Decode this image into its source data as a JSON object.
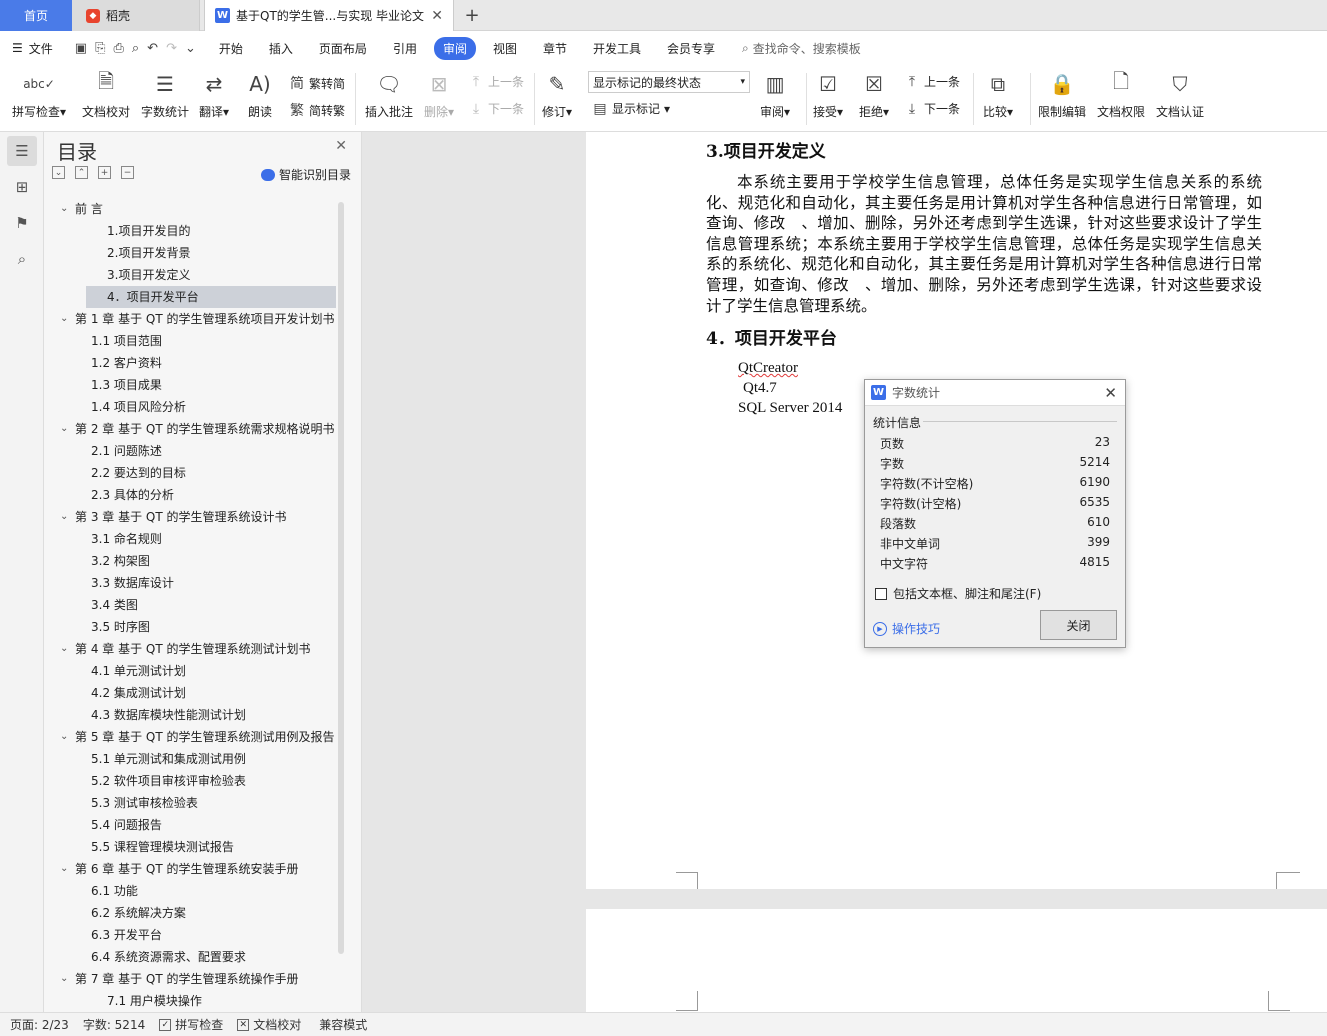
{
  "titlebar": {
    "home_tab": "首页",
    "daoke_tab": "稻壳",
    "doc_tab": "基于QT的学生管...与实现 毕业论文",
    "add_tab": "+"
  },
  "menubar": {
    "file": "文件",
    "tabs": [
      "开始",
      "插入",
      "页面布局",
      "引用",
      "审阅",
      "视图",
      "章节",
      "开发工具",
      "会员专享"
    ],
    "active_tab": "审阅",
    "search_placeholder": "查找命令、搜索模板"
  },
  "ribbon": {
    "spell_check": "拼写检查",
    "doc_proof": "文档校对",
    "word_count": "字数统计",
    "translate": "翻译",
    "read_aloud": "朗读",
    "trad_to_simp": "繁转简",
    "simp_to_trad": "简转繁",
    "insert_comment": "插入批注",
    "delete": "删除",
    "prev_comment": "上一条",
    "next_comment": "下一条",
    "track_changes": "修订",
    "markup_mode": "显示标记的最终状态",
    "show_markup": "显示标记",
    "review": "审阅",
    "accept": "接受",
    "reject": "拒绝",
    "prev_change": "上一条",
    "next_change": "下一条",
    "compare": "比较",
    "restrict_edit": "限制编辑",
    "doc_permission": "文档权限",
    "doc_certify": "文档认证"
  },
  "toc": {
    "title": "目录",
    "smart_recognize": "智能识别目录",
    "items": [
      {
        "level": 1,
        "text": "前 言",
        "expanded": true
      },
      {
        "level": 3,
        "text": "1.项目开发目的"
      },
      {
        "level": 3,
        "text": "2.项目开发背景"
      },
      {
        "level": 3,
        "text": "3.项目开发定义"
      },
      {
        "level": 3,
        "text": "4．项目开发平台",
        "selected": true
      },
      {
        "level": 1,
        "text": "第 1 章 基于 QT 的学生管理系统项目开发计划书",
        "expanded": true
      },
      {
        "level": 2,
        "text": "1.1 项目范围"
      },
      {
        "level": 2,
        "text": "1.2 客户资料"
      },
      {
        "level": 2,
        "text": "1.3 项目成果"
      },
      {
        "level": 2,
        "text": "1.4 项目风险分析"
      },
      {
        "level": 1,
        "text": "第 2 章 基于 QT 的学生管理系统需求规格说明书",
        "expanded": true
      },
      {
        "level": 2,
        "text": "2.1 问题陈述"
      },
      {
        "level": 2,
        "text": "2.2 要达到的目标"
      },
      {
        "level": 2,
        "text": "2.3 具体的分析"
      },
      {
        "level": 1,
        "text": "第 3 章 基于 QT 的学生管理系统设计书",
        "expanded": true
      },
      {
        "level": 2,
        "text": "3.1 命名规则"
      },
      {
        "level": 2,
        "text": "3.2 构架图"
      },
      {
        "level": 2,
        "text": "3.3 数据库设计"
      },
      {
        "level": 2,
        "text": "3.4 类图"
      },
      {
        "level": 2,
        "text": "3.5 时序图"
      },
      {
        "level": 1,
        "text": "第 4 章 基于 QT 的学生管理系统测试计划书",
        "expanded": true
      },
      {
        "level": 2,
        "text": "4.1 单元测试计划"
      },
      {
        "level": 2,
        "text": "4.2 集成测试计划"
      },
      {
        "level": 2,
        "text": "4.3 数据库模块性能测试计划"
      },
      {
        "level": 1,
        "text": "第 5 章 基于 QT 的学生管理系统测试用例及报告",
        "expanded": true
      },
      {
        "level": 2,
        "text": "5.1 单元测试和集成测试用例"
      },
      {
        "level": 2,
        "text": "5.2 软件项目审核评审检验表"
      },
      {
        "level": 2,
        "text": "5.3 测试审核检验表"
      },
      {
        "level": 2,
        "text": "5.4 问题报告"
      },
      {
        "level": 2,
        "text": "5.5 课程管理模块测试报告"
      },
      {
        "level": 1,
        "text": "第 6 章 基于 QT 的学生管理系统安装手册",
        "expanded": true
      },
      {
        "level": 2,
        "text": "6.1 功能"
      },
      {
        "level": 2,
        "text": "6.2 系统解决方案"
      },
      {
        "level": 2,
        "text": "6.3 开发平台"
      },
      {
        "level": 2,
        "text": "6.4 系统资源需求、配置要求"
      },
      {
        "level": 1,
        "text": "第 7 章 基于 QT 的学生管理系统操作手册",
        "expanded": true
      },
      {
        "level": 3,
        "text": "7.1 用户模块操作"
      }
    ]
  },
  "document": {
    "heading3": "3.项目开发定义",
    "paragraph": "本系统主要用于学校学生信息管理，总体任务是实现学生信息关系的系统化、规范化和自动化，其主要任务是用计算机对学生各种信息进行日常管理，如查询、修改　、增加、删除，另外还考虑到学生选课，针对这些要求设计了学生信息管理系统；本系统主要用于学校学生信息管理，总体任务是实现学生信息关系的系统化、规范化和自动化，其主要任务是用计算机对学生各种信息进行日常管理，如查询、修改　、增加、删除，另外还考虑到学生选课，针对这些要求设计了学生信息管理系统。",
    "heading4": "4．项目开发平台",
    "lines": [
      "QtCreator",
      "Qt4.7",
      "SQL Server 2014"
    ]
  },
  "dialog": {
    "title": "字数统计",
    "section": "统计信息",
    "stats": [
      {
        "label": "页数",
        "value": "23"
      },
      {
        "label": "字数",
        "value": "5214"
      },
      {
        "label": "字符数(不计空格)",
        "value": "6190"
      },
      {
        "label": "字符数(计空格)",
        "value": "6535"
      },
      {
        "label": "段落数",
        "value": "610"
      },
      {
        "label": "非中文单词",
        "value": "399"
      },
      {
        "label": "中文字符",
        "value": "4815"
      }
    ],
    "checkbox": "包括文本框、脚注和尾注(F)",
    "tips": "操作技巧",
    "close_button": "关闭"
  },
  "statusbar": {
    "page": "页面: 2/23",
    "words": "字数: 5214",
    "spell_check": "拼写检查",
    "doc_proof": "文档校对",
    "compat_mode": "兼容模式"
  }
}
